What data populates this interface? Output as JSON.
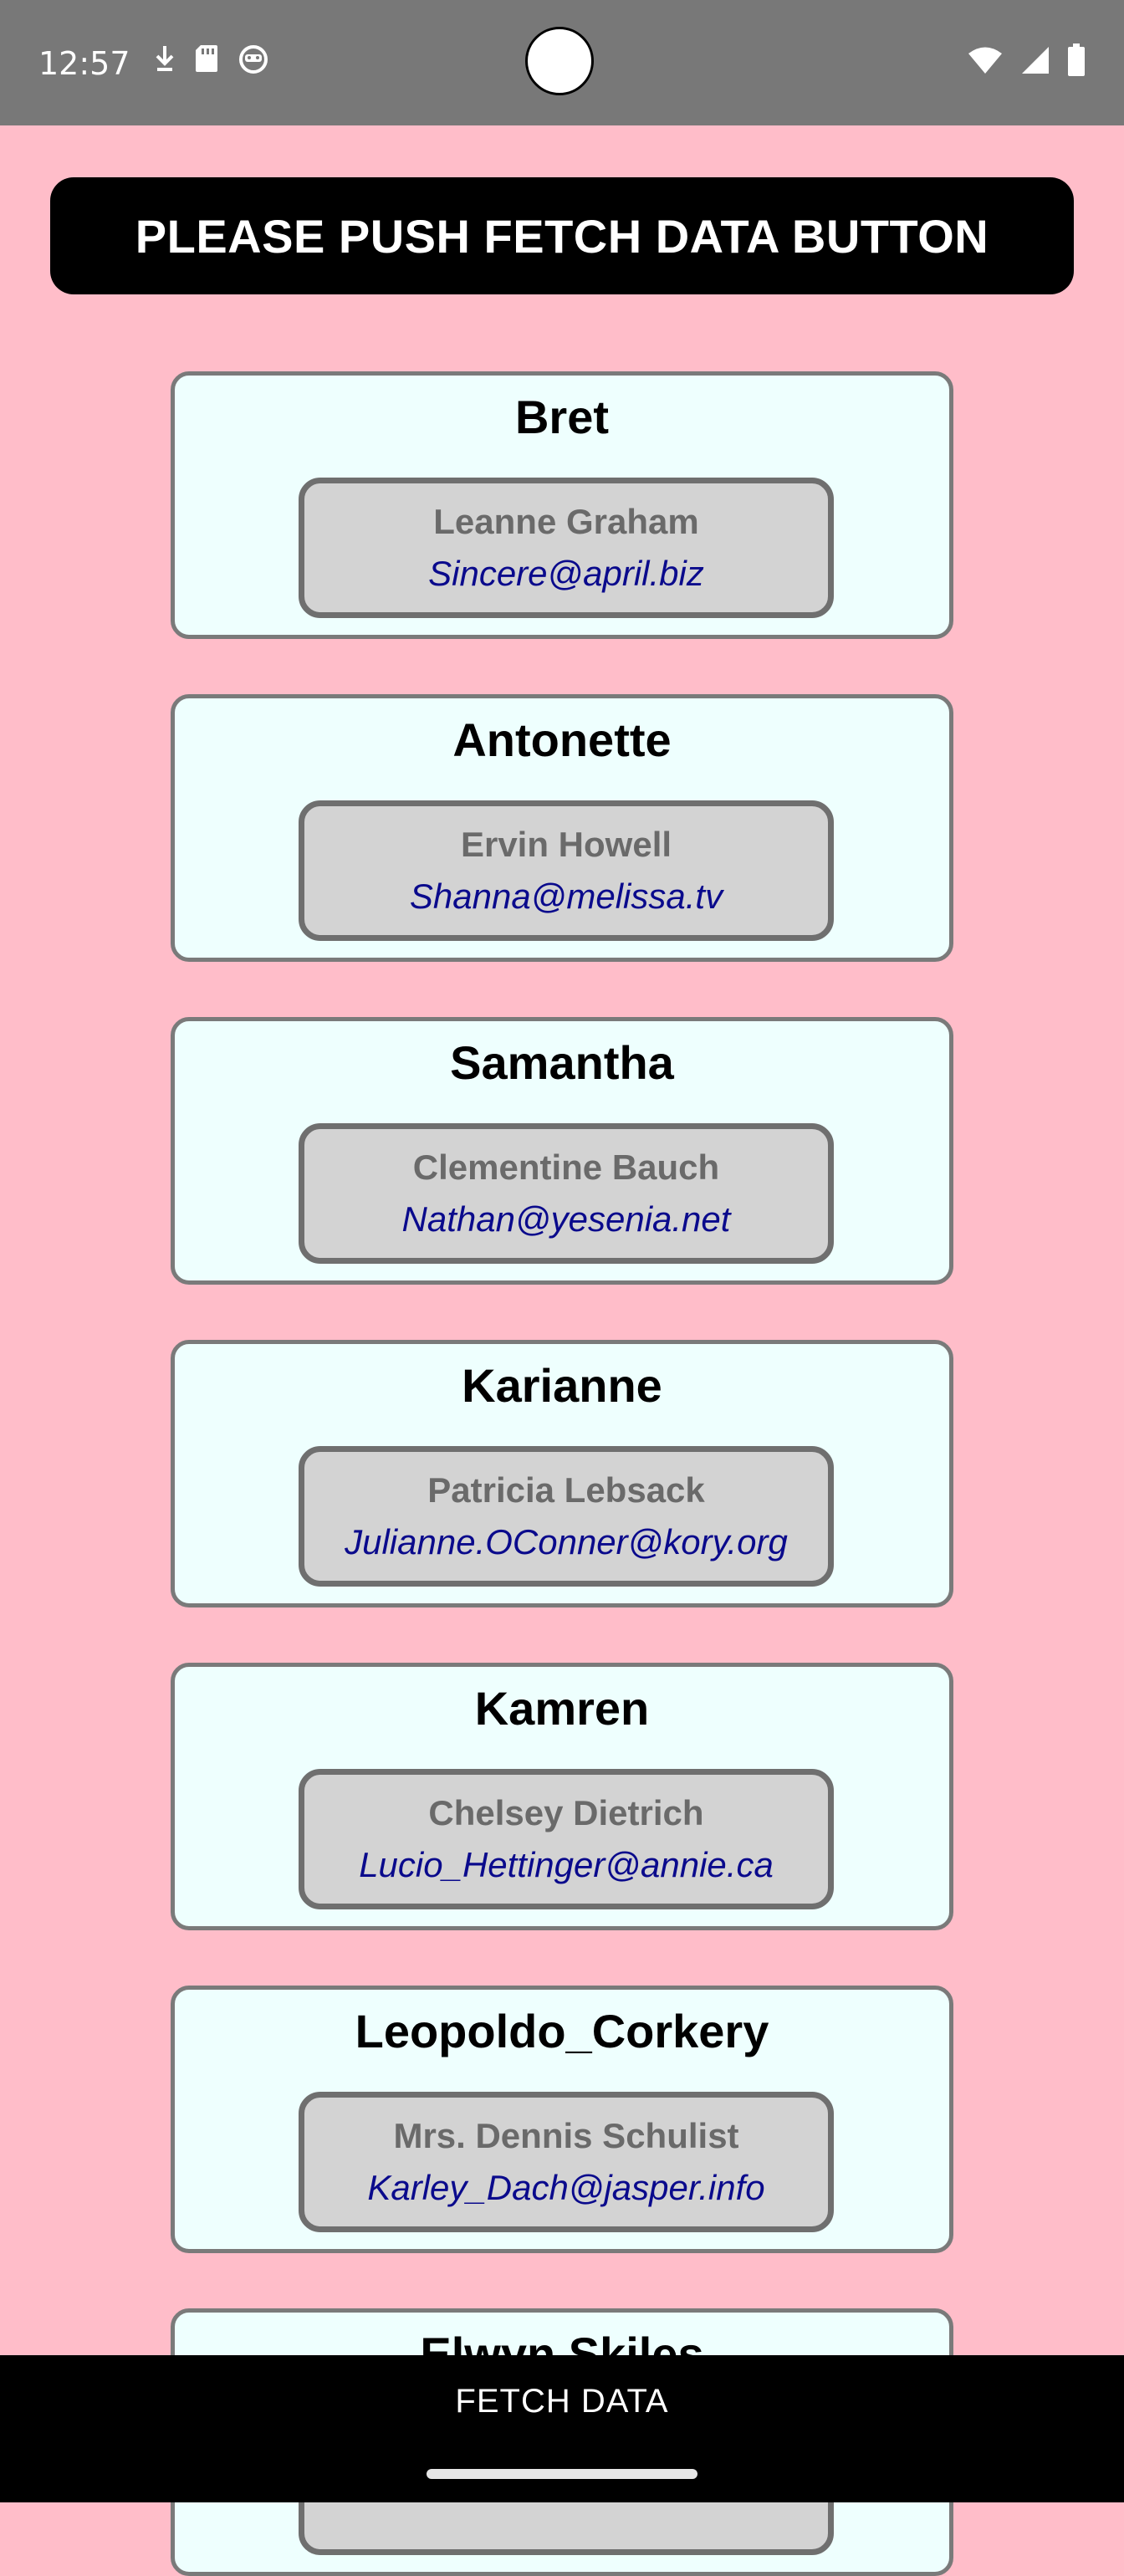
{
  "status_bar": {
    "time": "12:57",
    "left_icons": [
      "download-status-icon",
      "sd-card-icon",
      "assistant-icon"
    ],
    "right_icons": [
      "wifi-icon",
      "cellular-signal-icon",
      "battery-icon"
    ]
  },
  "header": {
    "message": "PLEASE PUSH FETCH DATA BUTTON"
  },
  "users": [
    {
      "username": "Bret",
      "name": "Leanne Graham",
      "email": "Sincere@april.biz"
    },
    {
      "username": "Antonette",
      "name": "Ervin Howell",
      "email": "Shanna@melissa.tv"
    },
    {
      "username": "Samantha",
      "name": "Clementine Bauch",
      "email": "Nathan@yesenia.net"
    },
    {
      "username": "Karianne",
      "name": "Patricia Lebsack",
      "email": "Julianne.OConner@kory.org"
    },
    {
      "username": "Kamren",
      "name": "Chelsey Dietrich",
      "email": "Lucio_Hettinger@annie.ca"
    },
    {
      "username": "Leopoldo_Corkery",
      "name": "Mrs. Dennis Schulist",
      "email": "Karley_Dach@jasper.info"
    },
    {
      "username": "Elwyn.Skiles",
      "name": "",
      "email": ""
    }
  ],
  "bottom": {
    "fetch_label": "FETCH DATA"
  },
  "colors": {
    "background": "#ffbdc9",
    "status_bar": "#787878",
    "card_bg": "#eefffe",
    "inner_bg": "#d3d3d3",
    "email_text": "#0a0a8c"
  }
}
